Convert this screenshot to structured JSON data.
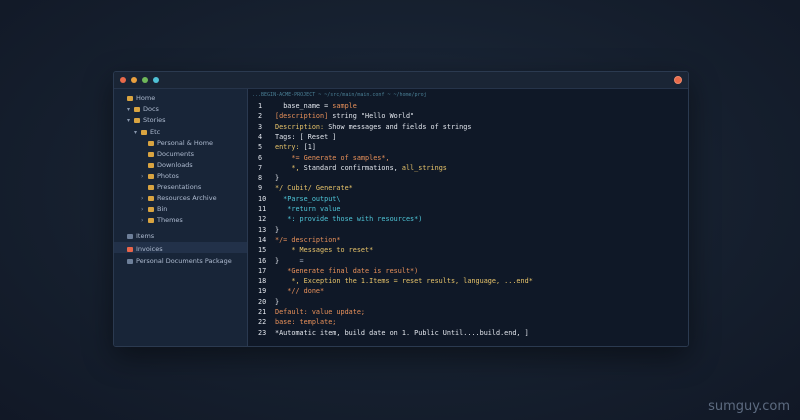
{
  "window": {
    "path_text": "...BEGIN-ACME-PROJECT ~ ~/src/main/main.conf ~ ~/home/proj",
    "colors": {
      "close": "#e96a4a",
      "minimize": "#e9a03f",
      "maximize": "#6fb85a",
      "extra": "#4fc1d6"
    }
  },
  "sidebar": {
    "items": [
      {
        "label": "Home",
        "icon": "folder-icon",
        "indent": 0,
        "chev": ""
      },
      {
        "label": "Docs",
        "icon": "folder-icon",
        "indent": 1,
        "chev": "▾"
      },
      {
        "label": "Stories",
        "icon": "folder-icon",
        "indent": 1,
        "chev": "▾"
      },
      {
        "label": "Etc",
        "icon": "folder-icon",
        "indent": 2,
        "chev": "▾"
      },
      {
        "label": "Personal & Home",
        "icon": "folder-icon",
        "indent": 3,
        "chev": ""
      },
      {
        "label": "Documents",
        "icon": "folder-icon",
        "indent": 3,
        "chev": ""
      },
      {
        "label": "Downloads",
        "icon": "folder-icon",
        "indent": 3,
        "chev": ""
      },
      {
        "label": "Photos",
        "icon": "folder-icon",
        "indent": 3,
        "chev": "›"
      },
      {
        "label": "Presentations",
        "icon": "folder-icon",
        "indent": 3,
        "chev": ""
      },
      {
        "label": "Resources Archive",
        "icon": "folder-icon",
        "indent": 3,
        "chev": "›"
      },
      {
        "label": "Bin",
        "icon": "folder-icon",
        "indent": 3,
        "chev": "›"
      },
      {
        "label": "Themes",
        "icon": "folder-icon",
        "indent": 3,
        "chev": "›"
      },
      {
        "label": "Items",
        "icon": "file-icon",
        "indent": 0,
        "chev": ""
      },
      {
        "label": "Invoices",
        "icon": "red-file-icon",
        "indent": 0,
        "chev": ""
      },
      {
        "label": "Personal Documents Package",
        "icon": "file-icon",
        "indent": 0,
        "chev": ""
      }
    ]
  },
  "editor": {
    "lines": [
      {
        "n": "1",
        "parts": [
          [
            "w",
            "  "
          ],
          [
            "c-w",
            "base_name = "
          ],
          [
            "c-o",
            "sample"
          ]
        ]
      },
      {
        "n": "2",
        "parts": [
          [
            "c-o",
            "[description] "
          ],
          [
            "c-w",
            "string \"Hello World\""
          ]
        ]
      },
      {
        "n": "3",
        "parts": [
          [
            "c-y",
            "Description: "
          ],
          [
            "c-w",
            "Show messages and fields of strings"
          ]
        ]
      },
      {
        "n": "4",
        "parts": [
          [
            "c-w",
            "Tags: [ Reset ]"
          ]
        ]
      },
      {
        "n": "5",
        "parts": [
          [
            "c-y",
            "entry: "
          ],
          [
            "c-w",
            "[1]"
          ]
        ]
      },
      {
        "n": "6",
        "parts": [
          [
            "c-o",
            "    *= Generate of samples*,"
          ]
        ]
      },
      {
        "n": "7",
        "parts": [
          [
            "c-y",
            "    *, "
          ],
          [
            "c-w",
            "Standard confirmations, "
          ],
          [
            "c-y",
            "all_strings"
          ]
        ]
      },
      {
        "n": "8",
        "parts": [
          [
            "c-w",
            "}"
          ]
        ]
      },
      {
        "n": "9",
        "parts": [
          [
            "c-y",
            "*/ Cubit/ Generate*"
          ]
        ]
      },
      {
        "n": "10",
        "parts": [
          [
            "c-c",
            "  *Parse_output\\"
          ]
        ]
      },
      {
        "n": "11",
        "parts": [
          [
            "c-c",
            "   *return value"
          ]
        ]
      },
      {
        "n": "12",
        "parts": [
          [
            "c-c",
            "   *: provide those with resources*)"
          ]
        ]
      },
      {
        "n": "13",
        "parts": [
          [
            "c-w",
            "}"
          ]
        ]
      },
      {
        "n": "14",
        "parts": [
          [
            "c-o",
            "*/= description*"
          ]
        ]
      },
      {
        "n": "15",
        "parts": [
          [
            "c-y",
            "    * Messages to reset*"
          ]
        ]
      },
      {
        "n": "16",
        "parts": [
          [
            "c-w",
            "}"
          ],
          [
            "c-g",
            "     ="
          ]
        ]
      },
      {
        "n": "17",
        "parts": [
          [
            "c-o",
            "   *Generate final date is result*)"
          ]
        ]
      },
      {
        "n": "18",
        "parts": [
          [
            "c-y",
            "    *, Exception the 1.Items = reset results, language, ...end*"
          ]
        ]
      },
      {
        "n": "19",
        "parts": [
          [
            "c-o",
            "   *// done*"
          ]
        ]
      },
      {
        "n": "20",
        "parts": [
          [
            "c-w",
            "}"
          ]
        ]
      },
      {
        "n": "21",
        "parts": [
          [
            "c-o",
            "Default: value update;"
          ]
        ]
      },
      {
        "n": "22",
        "parts": [
          [
            "c-o",
            "base: template;"
          ]
        ]
      },
      {
        "n": "23",
        "parts": [
          [
            "c-w",
            "*Automatic item, build date on 1. Public Until....build.end, ]"
          ]
        ]
      }
    ]
  }
}
